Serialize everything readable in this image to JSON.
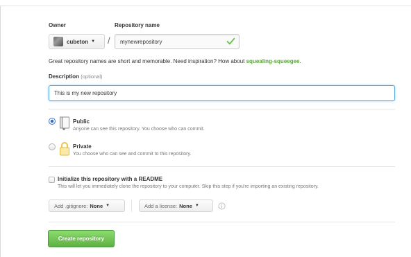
{
  "owner": {
    "label": "Owner",
    "name": "cubeton"
  },
  "repository": {
    "label": "Repository name",
    "value": "mynewrepository",
    "separator": "/"
  },
  "hint": {
    "text": "Great repository names are short and memorable. Need inspiration? How about ",
    "suggestion": "squealing-squeegee",
    "suffix": "."
  },
  "description": {
    "label": "Description",
    "optional": "(optional)",
    "value": "This is my new repository"
  },
  "visibility": {
    "selected": "public",
    "public": {
      "title": "Public",
      "desc": "Anyone can see this repository. You choose who can commit."
    },
    "private": {
      "title": "Private",
      "desc": "You choose who can see and commit to this repository."
    }
  },
  "readme": {
    "checked": false,
    "title": "Initialize this repository with a README",
    "desc": "This will let you immediately clone the repository to your computer. Skip this step if you're importing an existing repository."
  },
  "gitignore": {
    "label": "Add .gitignore:",
    "value": "None"
  },
  "license": {
    "label": "Add a license:",
    "value": "None"
  },
  "create_button": "Create repository",
  "colors": {
    "accent_green": "#55a532",
    "button_green": "#60b044",
    "focus_blue": "#51a7e8",
    "check_green": "#6cc644"
  },
  "icons": {
    "owner_caret": "caret-down-icon",
    "valid": "check-icon",
    "public": "repo-icon",
    "private": "lock-icon",
    "info": "info-icon"
  }
}
